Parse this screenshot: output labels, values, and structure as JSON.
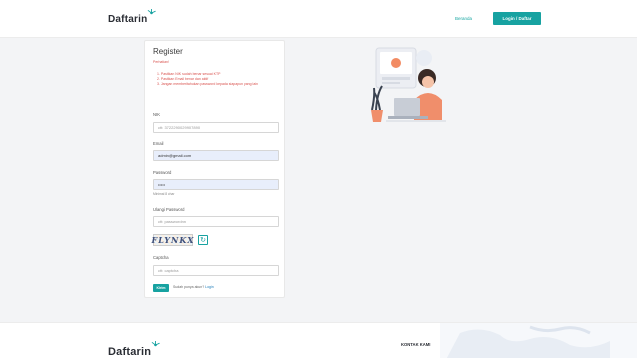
{
  "brand": {
    "name": "Daftarin"
  },
  "header": {
    "nav_link": "Beranda",
    "nav_button": "Login / Daftar"
  },
  "register": {
    "title": "Register",
    "note_heading": "Perhatian!",
    "notes": [
      "1. Pastikan NIK sudah benar sesuai KTP",
      "2. Pastikan Email benar dan aktif",
      "3. Jangan memberitahukan password kepada siapapun yang lain"
    ],
    "nik": {
      "label": "NIK",
      "placeholder": "ctt: 3722290029907890"
    },
    "email": {
      "label": "Email",
      "value": "admin@gmail.com"
    },
    "password": {
      "label": "Password",
      "value": "•••••",
      "hint": "Minimal 8 char"
    },
    "password_repeat": {
      "label": "Ulangi Password",
      "placeholder": "ctt: passwordnn"
    },
    "captcha": {
      "text": "FLYNKX",
      "refresh_icon": "refresh-icon"
    },
    "captcha_input": {
      "label": "Captcha",
      "placeholder": "ctt: captcha"
    },
    "submit_label": "Kirim",
    "login_prompt": "Sudah punya akun?",
    "login_link": "Login"
  },
  "footer": {
    "contact_heading": "KONTAK KAMI"
  },
  "colors": {
    "accent": "#17a2a1",
    "error": "#d9534f",
    "link": "#1a7ab8",
    "logo_mark": "#17a2a1"
  }
}
